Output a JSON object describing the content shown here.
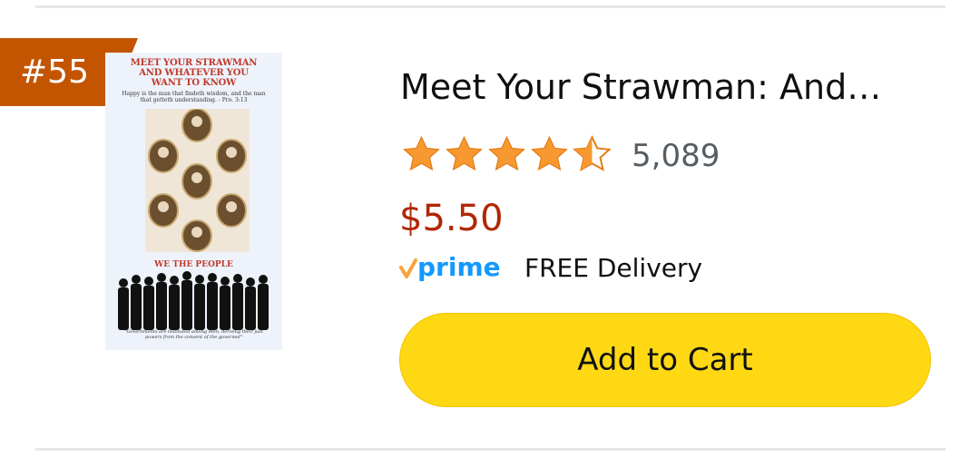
{
  "product": {
    "rank": "#55",
    "title": "Meet Your Strawman: And…",
    "rating": 4.5,
    "rating_count": "5,089",
    "price": "$5.50",
    "prime_badge": "prime",
    "delivery": "FREE Delivery",
    "add_to_cart_label": "Add to Cart"
  },
  "cover": {
    "title_line1": "MEET YOUR STRAWMAN",
    "title_line2": "AND WHATEVER YOU",
    "title_line3": "WANT TO KNOW",
    "verse": "Happy is the man that findeth wisdom, and the man that getteth understanding. - Pro. 3:13",
    "people_label": "WE THE PEOPLE",
    "quote": "\"Governments are instituted among Men, deriving their just powers from the consent of the governed\""
  },
  "colors": {
    "badge": "#c45500",
    "price": "#b12704",
    "star": "#f69931",
    "button": "#ffd814",
    "prime_blue": "#1399ff",
    "prime_check": "#f7a33a"
  },
  "icons": {
    "star_full": "star-icon",
    "star_half": "star-half-icon",
    "prime": "prime-logo"
  }
}
